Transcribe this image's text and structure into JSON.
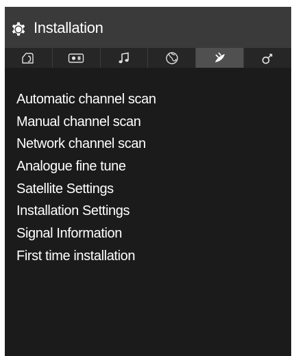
{
  "header": {
    "title": "Installation",
    "title_icon": "gear-icon"
  },
  "tabs": [
    {
      "icon": "picture-icon",
      "active": false
    },
    {
      "icon": "sound-mode-icon",
      "active": false
    },
    {
      "icon": "music-note-icon",
      "active": false
    },
    {
      "icon": "globe-icon",
      "active": false
    },
    {
      "icon": "satellite-dish-icon",
      "active": true
    },
    {
      "icon": "settings-key-icon",
      "active": false
    }
  ],
  "menu_items": [
    "Automatic channel scan",
    "Manual channel scan",
    "Network channel scan",
    "Analogue fine tune",
    "Satellite Settings",
    "Installation Settings",
    "Signal Information",
    "First time installation"
  ],
  "colors": {
    "background": "#1b1b1b",
    "header": "#3a3a3a",
    "tab_bar": "#262626",
    "tab_active": "#505050",
    "text": "#ffffff"
  }
}
